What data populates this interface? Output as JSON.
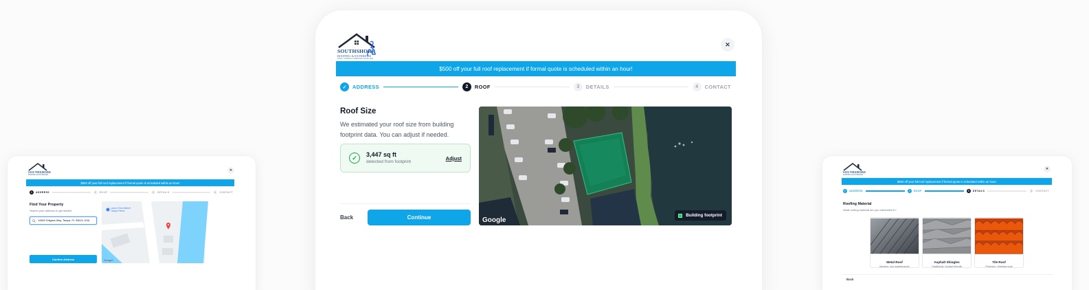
{
  "brand": {
    "name": "SOUTHSHORE",
    "tagline": "ROOFING & EXTERIORS",
    "subline": "FAMILY OWNED & OPERATED SINCE 1999"
  },
  "banner": "$500 off your full roof replacement if formal quote is scheduled within an hour!",
  "close_symbol": "✕",
  "steps": [
    {
      "num": "1",
      "label": "ADDRESS"
    },
    {
      "num": "2",
      "label": "ROOF"
    },
    {
      "num": "3",
      "label": "DETAILS"
    },
    {
      "num": "4",
      "label": "CONTACT"
    }
  ],
  "main": {
    "title": "Roof Size",
    "description": "We estimated your roof size from building footprint data. You can adjust if needed.",
    "estimate_value": "3,447 sq ft",
    "estimate_source": "detected from footprint",
    "adjust_label": "Adjust",
    "back_label": "Back",
    "continue_label": "Continue",
    "map_attribution": "Google",
    "footprint_label": "Building footprint"
  },
  "left_card": {
    "title": "Find Your Property",
    "subtitle": "Search your address to get started",
    "address_value": "14969 Grilgans Way, Tampa, FL 33613, USA",
    "confirm_label": "Confirm Address",
    "map_poi": "Land & Sea Market Tampa Palms",
    "map_attribution": "Google"
  },
  "right_card": {
    "title": "Roofing Material",
    "subtitle": "What roofing material are you interested in?",
    "back_label": "Back",
    "materials": [
      {
        "name": "Metal Roof",
        "desc": "Modern, low maintenance"
      },
      {
        "name": "Asphalt Shingles",
        "desc": "Traditional, budget friendly"
      },
      {
        "name": "Tile Roof",
        "desc": "Premium, timeless look"
      }
    ]
  },
  "colors": {
    "accent": "#0ea5e9",
    "success": "#16a34a",
    "brand_blue": "#1f4e8c"
  }
}
